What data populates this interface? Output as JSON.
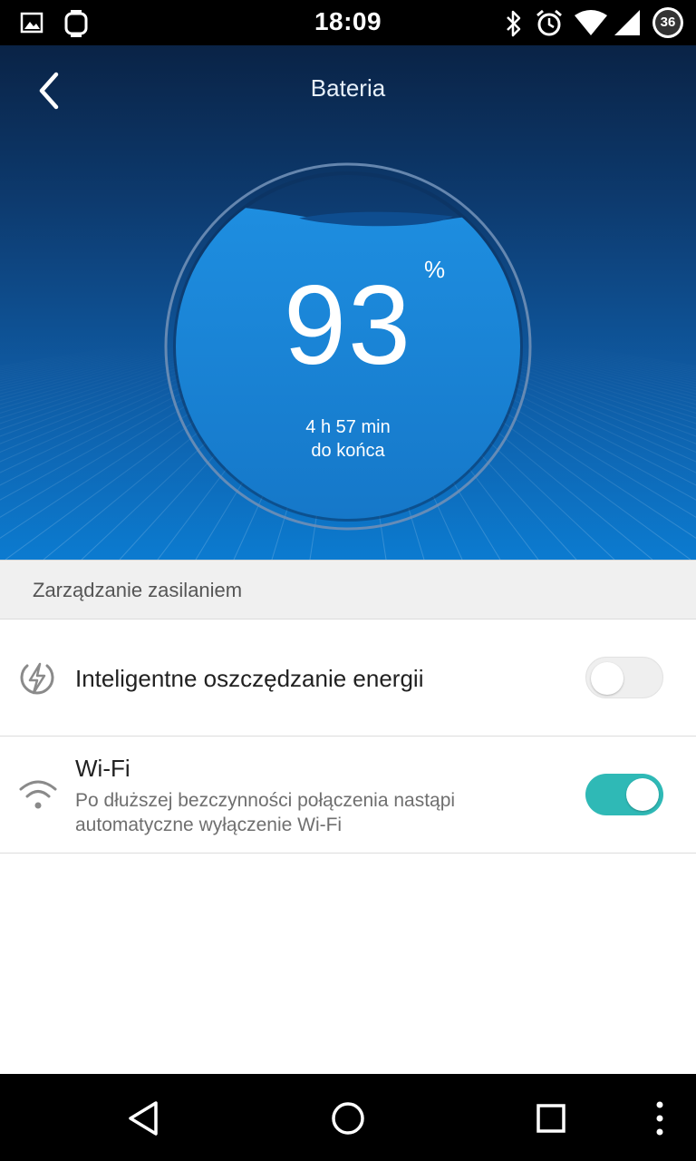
{
  "status_bar": {
    "time": "18:09",
    "battery_level": "36",
    "icons": [
      "image-notification-icon",
      "watch-notification-icon",
      "bluetooth-icon",
      "alarm-icon",
      "wifi-signal-icon",
      "cell-signal-icon",
      "battery-icon"
    ]
  },
  "header": {
    "title": "Bateria",
    "back_icon": "chevron-left-icon"
  },
  "battery": {
    "percent": "93",
    "percent_sign": "%",
    "level_fraction": 0.93,
    "time_left": "4 h 57 min",
    "time_left_suffix": "do końca"
  },
  "section": {
    "title": "Zarządzanie zasilaniem"
  },
  "settings": [
    {
      "title": "Inteligentne oszczędzanie energii",
      "icon": "power-save-icon",
      "enabled": false
    },
    {
      "title": "Wi-Fi",
      "description": "Po dłuższej bezczynności połączenia nastąpi automatyczne wyłączenie Wi-Fi",
      "icon": "wifi-icon",
      "enabled": true
    }
  ],
  "colors": {
    "toggle_on": "#2fb9b6",
    "hero_top": "#0a2346",
    "hero_bottom": "#0c7bd0",
    "gauge_fill": "#1a86d8"
  },
  "nav_bar": {
    "icons": [
      "back-triangle-icon",
      "home-circle-icon",
      "recents-square-icon",
      "overflow-menu-icon"
    ]
  }
}
